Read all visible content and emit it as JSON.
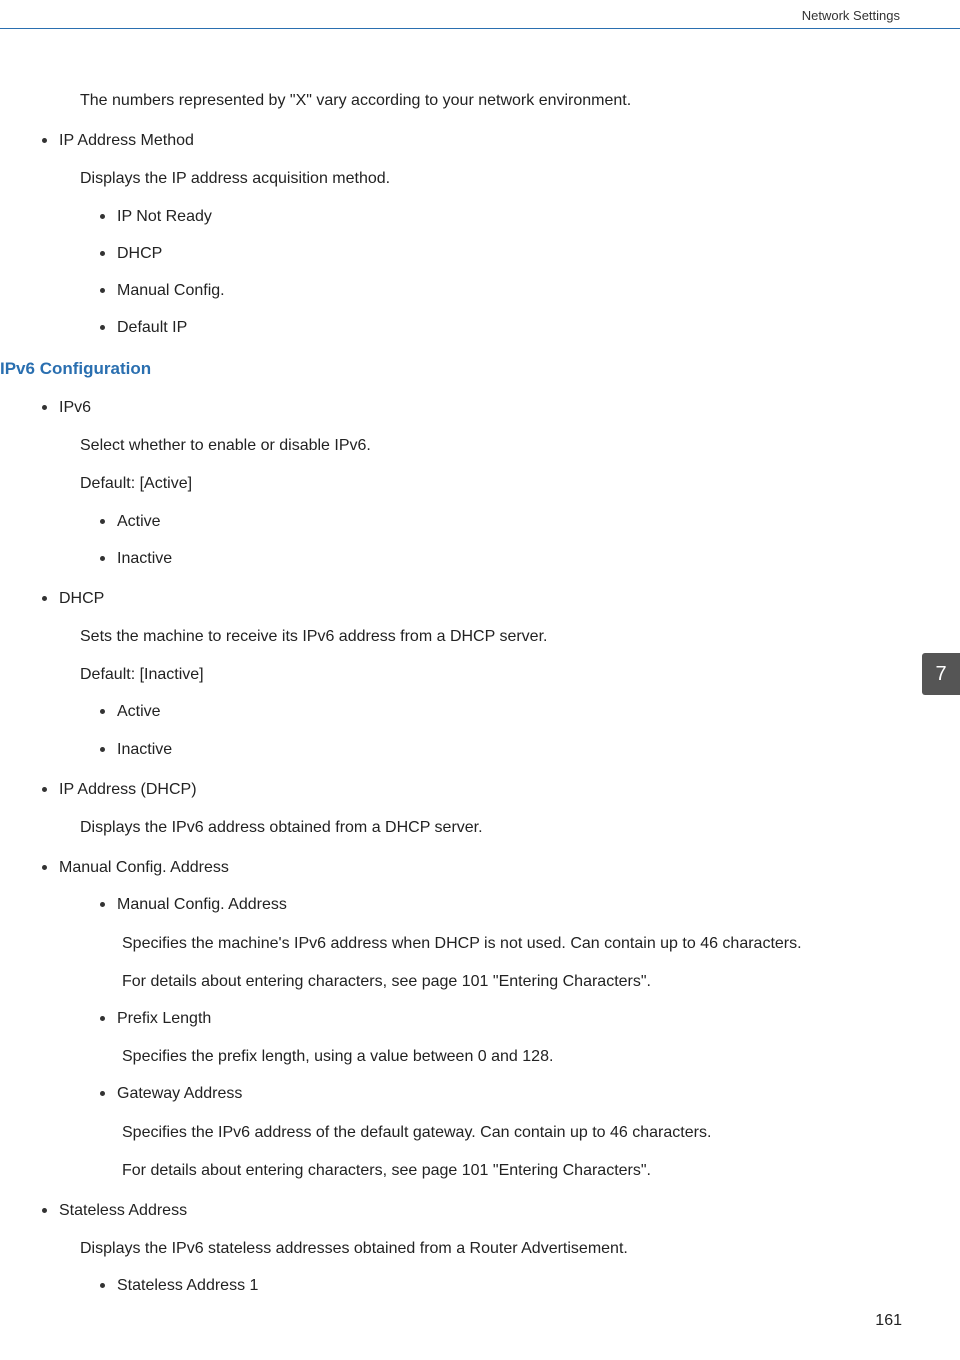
{
  "header": {
    "running_title": "Network Settings"
  },
  "intro": "The numbers represented by \"X\" vary according to your network environment.",
  "ip_method": {
    "title": "IP Address Method",
    "desc": "Displays the IP address acquisition method.",
    "items": [
      "IP Not Ready",
      "DHCP",
      "Manual Config.",
      "Default IP"
    ]
  },
  "ipv6": {
    "heading": "IPv6 Configuration",
    "ipv6_item": {
      "title": "IPv6",
      "desc": "Select whether to enable or disable IPv6.",
      "default": "Default: [Active]",
      "options": [
        "Active",
        "Inactive"
      ]
    },
    "dhcp_item": {
      "title": "DHCP",
      "desc": "Sets the machine to receive its IPv6 address from a DHCP server.",
      "default": "Default: [Inactive]",
      "options": [
        "Active",
        "Inactive"
      ]
    },
    "ip_dhcp_item": {
      "title": "IP Address (DHCP)",
      "desc": "Displays the IPv6 address obtained from a DHCP server."
    },
    "manual_item": {
      "title": "Manual Config. Address",
      "sub1": {
        "title": "Manual Config. Address",
        "p1": "Specifies the machine's IPv6 address when DHCP is not used. Can contain up to 46 characters.",
        "p2": "For details about entering characters, see page 101 \"Entering Characters\"."
      },
      "sub2": {
        "title": "Prefix Length",
        "p1": "Specifies the prefix length, using a value between 0 and 128."
      },
      "sub3": {
        "title": "Gateway Address",
        "p1": "Specifies the IPv6 address of the default gateway. Can contain up to 46 characters.",
        "p2": "For details about entering characters, see page 101 \"Entering Characters\"."
      }
    },
    "stateless_item": {
      "title": "Stateless Address",
      "desc": "Displays the IPv6 stateless addresses obtained from a Router Advertisement.",
      "sub": [
        "Stateless Address 1"
      ]
    }
  },
  "tab": {
    "number": "7"
  },
  "footer": {
    "page_number": "161"
  }
}
